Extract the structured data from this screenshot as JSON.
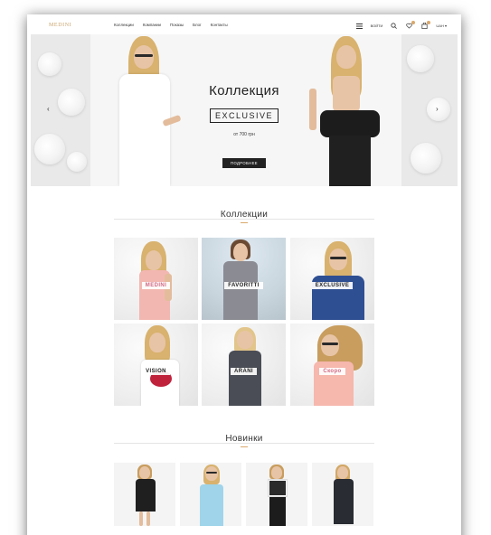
{
  "header": {
    "logo": "MEDINI",
    "nav": [
      "Коллекции",
      "Компании",
      "Показы",
      "Блог",
      "Контакты"
    ],
    "account": "ВОЙТИ",
    "currency": "UAH ▾"
  },
  "hero": {
    "title": "Коллекция",
    "subtitle": "EXCLUSIVE",
    "price": "от 700 грн",
    "button": "ПОДРОБНЕЕ",
    "prev_arrow": "‹",
    "next_arrow": "›"
  },
  "collections": {
    "title": "Коллекции",
    "items": [
      {
        "label": "MEDINI"
      },
      {
        "label": "FAVORITTI"
      },
      {
        "label": "EXCLUSIVE"
      },
      {
        "label": "VISION"
      },
      {
        "label": "ARANI"
      },
      {
        "label": "Скоро"
      }
    ]
  },
  "new_items": {
    "title": "Новинки"
  },
  "icons": {
    "menu": "menu-icon",
    "search": "search-icon",
    "wishlist": "heart-icon",
    "cart": "bag-icon"
  },
  "colors": {
    "accent": "#d9a86c",
    "dark": "#222222"
  }
}
